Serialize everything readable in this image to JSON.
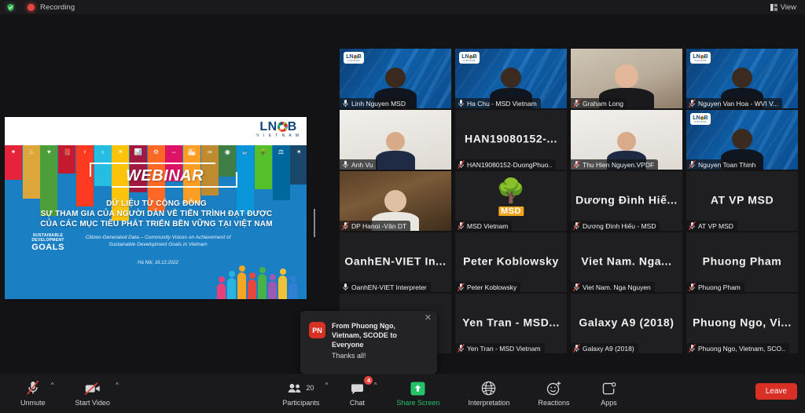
{
  "topbar": {
    "recording_label": "Recording",
    "view_label": "View",
    "shield_icon": "shield-check-icon",
    "record_icon": "record-dot-icon",
    "view_icon": "grid-view-icon"
  },
  "shared_screen": {
    "slide": {
      "logo_text": "LN",
      "logo_text2": "B",
      "logo_sub": "V I E T N A M",
      "webinar_label": "WEBINAR",
      "title_line1": "DỮ LIỆU TỪ CỘNG ĐỒNG",
      "title_line2": "SỰ THAM GIA CỦA NGƯỜI DÂN VỀ TIẾN TRÌNH ĐẠT ĐƯỢC",
      "title_line3": "CỦA CÁC MỤC TIÊU PHÁT TRIỂN BỀN VỮNG TẠI VIỆT NAM",
      "subtitle_line1": "Citizen-Generated Data – Community Voices on Achievement of",
      "subtitle_line2": "Sustainable Development Goals in Vietnam",
      "date": "Hà Nội, 16.12.2022",
      "sdg_mark_line1": "SUSTAINABLE",
      "sdg_mark_line2": "DEVELOPMENT",
      "sdg_mark_line3": "GOALS",
      "sdg_colors": [
        "#e5243b",
        "#dda63a",
        "#4c9f38",
        "#c5192d",
        "#ff3a21",
        "#26bde2",
        "#fcc30b",
        "#a21942",
        "#fd6925",
        "#dd1367",
        "#fd9d24",
        "#bf8b2e",
        "#3f7e44",
        "#0a97d9",
        "#56c02b",
        "#00689d",
        "#19486a"
      ],
      "sdg_icons": [
        "✦",
        "♨",
        "♥",
        "📕",
        "♀",
        "♁",
        "☀",
        "📊",
        "⚙",
        "⇔",
        "🏙",
        "∞",
        "◉",
        "🐟",
        "🌳",
        "⚖",
        "✶"
      ]
    }
  },
  "grid": {
    "tiles": [
      {
        "name": "Linh Nguyen MSD",
        "display": "",
        "bg": "lnob",
        "muted": false,
        "active": false,
        "col": 0,
        "row": 0
      },
      {
        "name": "Ha Chu - MSD Vietnam",
        "display": "",
        "bg": "lnob",
        "muted": false,
        "active": true,
        "col": 1,
        "row": 0
      },
      {
        "name": "Graham Long",
        "display": "",
        "bg": "room",
        "muted": true,
        "active": false,
        "col": 2,
        "row": 0
      },
      {
        "name": "Nguyen Van Hoa - WVI V...",
        "display": "",
        "bg": "lnob",
        "muted": true,
        "active": false,
        "col": 3,
        "row": 0
      },
      {
        "name": "Anh Vu",
        "display": "",
        "bg": "white",
        "muted": false,
        "active": false,
        "col": 0,
        "row": 1
      },
      {
        "name": "HAN19080152-DuongPhuo..",
        "display": "HAN19080152-...",
        "bg": "none",
        "muted": true,
        "active": false,
        "col": 1,
        "row": 1
      },
      {
        "name": "Thu Hien Nguyen.VPDF",
        "display": "",
        "bg": "white",
        "muted": true,
        "active": false,
        "col": 2,
        "row": 1
      },
      {
        "name": "Nguyen Toan Thinh",
        "display": "",
        "bg": "lnob",
        "muted": true,
        "active": false,
        "col": 3,
        "row": 1
      },
      {
        "name": "DP Hanoi -Vân DT",
        "display": "",
        "bg": "wood",
        "muted": true,
        "active": false,
        "col": 0,
        "row": 2
      },
      {
        "name": "MSD Vietnam",
        "display": "",
        "bg": "msd",
        "muted": true,
        "active": false,
        "col": 1,
        "row": 2
      },
      {
        "name": "Dương Đình Hiếu - MSD",
        "display": "Dương Đình Hiế...",
        "bg": "none",
        "muted": true,
        "active": false,
        "col": 2,
        "row": 2
      },
      {
        "name": "AT VP MSD",
        "display": "AT VP MSD",
        "bg": "none",
        "muted": true,
        "active": false,
        "col": 3,
        "row": 2
      },
      {
        "name": "OanhEN-VIET Interpreter",
        "display": "OanhEN-VIET  In...",
        "bg": "none",
        "muted": false,
        "active": false,
        "col": 0,
        "row": 3
      },
      {
        "name": "Peter Koblowsky",
        "display": "Peter Koblowsky",
        "bg": "none",
        "muted": true,
        "active": false,
        "col": 1,
        "row": 3
      },
      {
        "name": "Viet Nam. Nga Nguyen",
        "display": "Viet Nam. Nga...",
        "bg": "none",
        "muted": true,
        "active": false,
        "col": 2,
        "row": 3
      },
      {
        "name": "Phuong Pham",
        "display": "Phuong Pham",
        "bg": "none",
        "muted": true,
        "active": false,
        "col": 3,
        "row": 3
      },
      {
        "name": "",
        "display": "",
        "bg": "none",
        "muted": false,
        "active": false,
        "col": 0,
        "row": 4
      },
      {
        "name": "Yen Tran - MSD Vietnam",
        "display": "Yen Tran - MSD...",
        "bg": "none",
        "muted": true,
        "active": false,
        "col": 1,
        "row": 4
      },
      {
        "name": "Galaxy A9 (2018)",
        "display": "Galaxy A9 (2018)",
        "bg": "none",
        "muted": true,
        "active": false,
        "col": 2,
        "row": 4
      },
      {
        "name": "Phuong Ngo, Vietnam, SCO..",
        "display": "Phuong Ngo, Vi...",
        "bg": "none",
        "muted": true,
        "active": false,
        "col": 3,
        "row": 4
      }
    ],
    "msd_logo_word": "MSD",
    "msd_tree_icon": "tree-icon"
  },
  "chat_toast": {
    "avatar_initials": "PN",
    "from": "From Phuong Ngo, Vietnam, SCODE to Everyone",
    "message": "Thanks all!",
    "close_icon": "close-icon"
  },
  "toolbar": {
    "mute": {
      "label": "Unmute",
      "icon": "microphone-muted-icon"
    },
    "video": {
      "label": "Start Video",
      "icon": "camera-off-icon"
    },
    "participants": {
      "label": "Participants",
      "count": "20",
      "icon": "people-icon"
    },
    "chat": {
      "label": "Chat",
      "badge": "4",
      "icon": "chat-bubble-icon"
    },
    "share": {
      "label": "Share Screen",
      "icon": "share-screen-icon"
    },
    "interpretation": {
      "label": "Interpretation",
      "icon": "globe-icon"
    },
    "reactions": {
      "label": "Reactions",
      "icon": "smiley-plus-icon"
    },
    "apps": {
      "label": "Apps",
      "icon": "apps-icon"
    },
    "leave": {
      "label": "Leave"
    }
  },
  "colors": {
    "accent_green": "#25c26a",
    "leave_red": "#d93025",
    "active_speaker": "#d2e34a",
    "recording_red": "#e8473f"
  }
}
